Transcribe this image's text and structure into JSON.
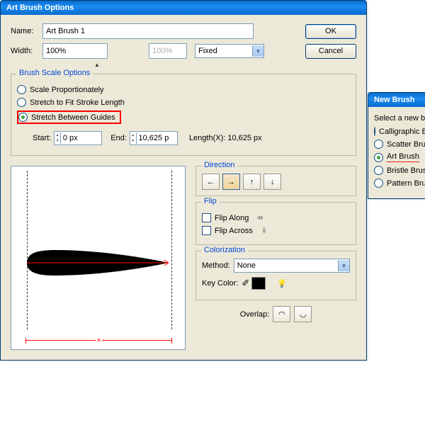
{
  "main": {
    "title": "Art Brush Options",
    "name_label": "Name:",
    "name_value": "Art Brush 1",
    "width_label": "Width:",
    "width_value": "100%",
    "width2_value": "100%",
    "width_mode": "Fixed",
    "ok": "OK",
    "cancel": "Cancel"
  },
  "scale": {
    "legend": "Brush Scale Options",
    "opt1": "Scale Proportionately",
    "opt2": "Stretch to Fit Stroke Length",
    "opt3": "Stretch Between Guides",
    "start_label": "Start:",
    "start_value": "0 px",
    "end_label": "End:",
    "end_value": "10,625 p",
    "length_label": "Length(X):  10,625 px"
  },
  "direction": {
    "legend": "Direction"
  },
  "flip": {
    "legend": "Flip",
    "along": "Flip Along",
    "across": "Flip Across"
  },
  "color": {
    "legend": "Colorization",
    "method_label": "Method:",
    "method_value": "None",
    "key_label": "Key Color:"
  },
  "overlap": {
    "label": "Overlap:"
  },
  "newbrush": {
    "title": "New Brush",
    "prompt": "Select a new brush type:",
    "o1": "Calligraphic Brush",
    "o2": "Scatter Brush",
    "o3": "Art Brush",
    "o4": "Bristle Brush",
    "o5": "Pattern Brush"
  }
}
